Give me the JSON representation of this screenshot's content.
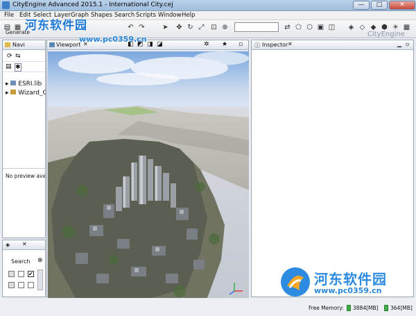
{
  "window": {
    "title": "CityEngine Advanced 2015.1 - International City.cej",
    "minimize": "—",
    "maximize": "□",
    "close": "✕"
  },
  "menu": [
    "File",
    "Edit",
    "Select",
    "Layer",
    "Graph",
    "Shapes",
    "Search",
    "Scripts",
    "Window",
    "Help"
  ],
  "toolbar": {
    "generate_label": "Generate",
    "search_value": "",
    "brand": "CityEngine"
  },
  "navigator": {
    "tab_label": "Navi",
    "items": [
      "ESRI.lib",
      "Wizard_Ci"
    ],
    "preview_text": "No preview avail"
  },
  "viewport": {
    "tab_label": "Viewport"
  },
  "inspector": {
    "tab_label": "Inspector"
  },
  "layers_panel": {
    "search_label": "Search"
  },
  "status": {
    "free_memory_label": "Free Memory:",
    "mem1": "3884[MB]",
    "mem2": "364[MB]"
  },
  "watermark": {
    "top_text": "河东软件园",
    "top_url": "www.pc0359.cn",
    "bottom_text": "河东软件园",
    "bottom_url": "www.pc0359.cn"
  },
  "colors": {
    "accent": "#1f7ad8",
    "memory_bar": "#3cb043"
  }
}
